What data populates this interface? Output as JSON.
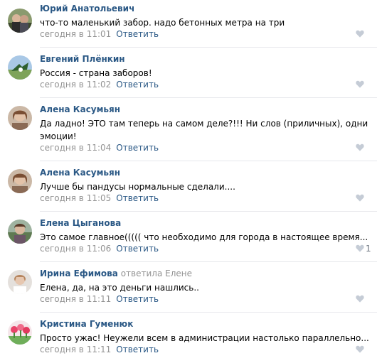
{
  "comments": [
    {
      "author": "Юрий Анатольевич",
      "reply_to": "",
      "lines": [
        "что-то маленький забор. надо бетонных метра на три"
      ],
      "time": "сегодня в 11:01",
      "reply_label": "Ответить",
      "likes": ""
    },
    {
      "author": "Евгений Плёнкин",
      "reply_to": "",
      "lines": [
        "Россия - страна заборов!"
      ],
      "time": "сегодня в 11:02",
      "reply_label": "Ответить",
      "likes": ""
    },
    {
      "author": "Алена Касумьян",
      "reply_to": "",
      "lines": [
        "Да ладно! ЭТО там теперь на самом деле?!!! Ни слов (приличных), одни",
        "эмоции!"
      ],
      "time": "сегодня в 11:04",
      "reply_label": "Ответить",
      "likes": ""
    },
    {
      "author": "Алена Касумьян",
      "reply_to": "",
      "lines": [
        "Лучше бы пандусы нормальные сделали...."
      ],
      "time": "сегодня в 11:05",
      "reply_label": "Ответить",
      "likes": ""
    },
    {
      "author": "Елена Цыганова",
      "reply_to": "",
      "lines": [
        "Это самое главное((((( что необходимо для города в настоящее время..."
      ],
      "time": "сегодня в 11:06",
      "reply_label": "Ответить",
      "likes": "1"
    },
    {
      "author": "Ирина Ефимова",
      "reply_to": "ответила Елене",
      "lines": [
        "Елена, да, на это деньги нашлись.."
      ],
      "time": "сегодня в 11:11",
      "reply_label": "Ответить",
      "likes": ""
    },
    {
      "author": "Кристина Гуменюк",
      "reply_to": "",
      "lines": [
        "Просто ужас! Неужели всем в администрации настолько параллельно..."
      ],
      "time": "сегодня в 11:11",
      "reply_label": "Ответить",
      "likes": ""
    }
  ],
  "icons": {
    "like": "heart-icon",
    "avatar": "user-avatar"
  },
  "colors": {
    "author": "#2a5885",
    "muted": "#939393",
    "like_icon": "#c5ccd6",
    "separator": "#e7e8ec"
  }
}
